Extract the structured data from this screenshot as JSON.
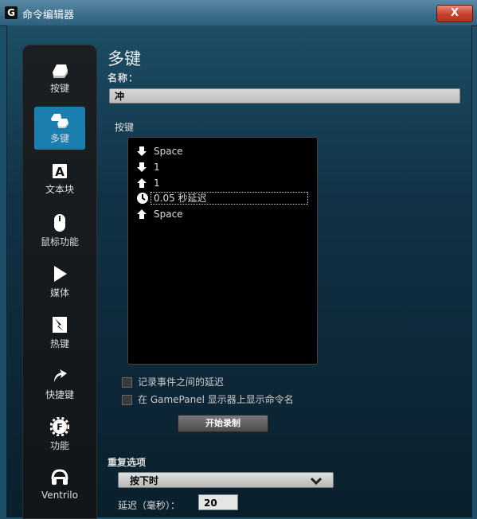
{
  "window": {
    "title": "命令编辑器",
    "close_label": "X"
  },
  "sidebar": {
    "items": [
      {
        "label": "按键",
        "icon": "key-icon",
        "active": false
      },
      {
        "label": "多键",
        "icon": "multi-key-icon",
        "active": true
      },
      {
        "label": "文本块",
        "icon": "text-block-icon",
        "active": false
      },
      {
        "label": "鼠标功能",
        "icon": "mouse-icon",
        "active": false
      },
      {
        "label": "媒体",
        "icon": "play-icon",
        "active": false
      },
      {
        "label": "热键",
        "icon": "hotkey-icon",
        "active": false
      },
      {
        "label": "快捷键",
        "icon": "shortcut-arrow-icon",
        "active": false
      },
      {
        "label": "功能",
        "icon": "function-gear-icon",
        "active": false
      },
      {
        "label": "Ventrilo",
        "icon": "headset-icon",
        "active": false
      }
    ]
  },
  "editor": {
    "heading": "多键",
    "name_label": "名称：",
    "name_value": "冲",
    "keys_label": "按键",
    "key_events": [
      {
        "icon": "arrow-down-icon",
        "text": "Space"
      },
      {
        "icon": "arrow-down-icon",
        "text": "1"
      },
      {
        "icon": "arrow-up-icon",
        "text": "1"
      },
      {
        "icon": "clock-icon",
        "text": "0.05 秒延迟"
      },
      {
        "icon": "arrow-up-icon",
        "text": "Space"
      }
    ],
    "record_delays_label": "记录事件之间的延迟",
    "show_name_label": "在 GamePanel 显示器上显示命令名",
    "start_record_label": "开始录制"
  },
  "repeat": {
    "label": "重复选项",
    "selected": "按下时",
    "delay_label": "延迟（毫秒）：",
    "delay_value": "20"
  }
}
